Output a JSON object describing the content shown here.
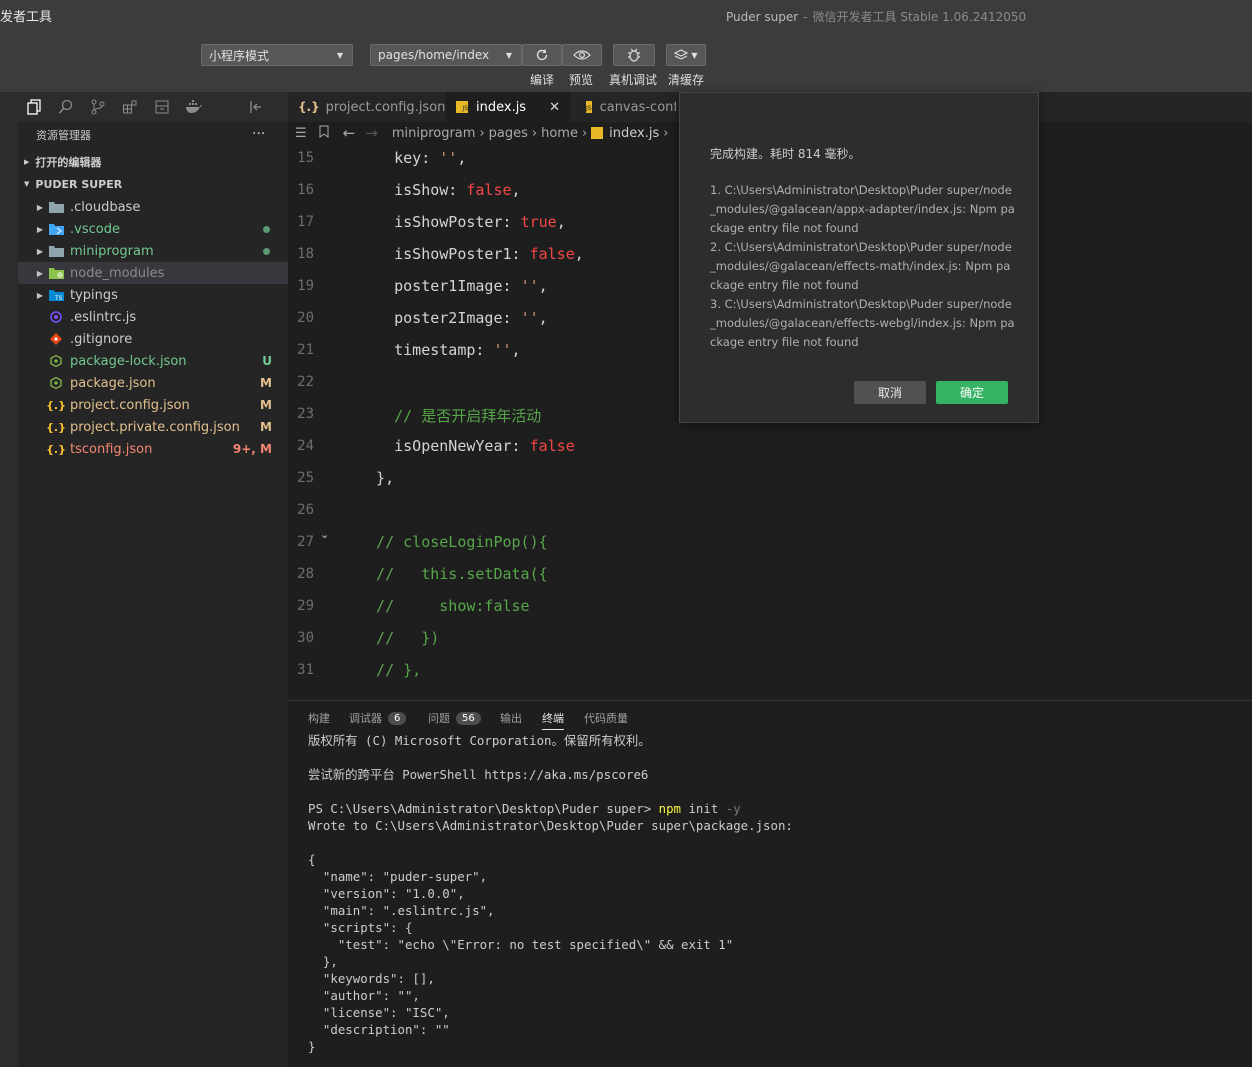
{
  "titlebar": {
    "app_title": "发者工具",
    "window_title": "Puder super",
    "window_subtitle": "微信开发者工具 Stable 1.06.2412050",
    "mode_select": "小程序模式",
    "page_select": "pages/home/index",
    "labels": {
      "compile": "编译",
      "preview": "预览",
      "real_debug": "真机调试",
      "clear_cache": "清缓存"
    }
  },
  "explorer": {
    "header": "资源管理器",
    "more": "···",
    "open_editors": "打开的编辑器",
    "project": "PUDER SUPER",
    "items": [
      {
        "label": ".cloudbase",
        "icon": "folder-icon",
        "color": "#cccccc",
        "badge": "",
        "dot": false
      },
      {
        "label": ".vscode",
        "icon": "vscode-folder-icon",
        "color": "#73c991",
        "badge": "",
        "dot": true
      },
      {
        "label": "miniprogram",
        "icon": "folder-icon",
        "color": "#73c991",
        "badge": "",
        "dot": true
      },
      {
        "label": "node_modules",
        "icon": "node-folder-icon",
        "color": "#8c8c8c",
        "badge": "",
        "dot": false
      },
      {
        "label": "typings",
        "icon": "ts-folder-icon",
        "color": "#cccccc",
        "badge": "",
        "dot": false
      },
      {
        "label": ".eslintrc.js",
        "icon": "eslint-icon",
        "color": "#cccccc",
        "badge": "",
        "dot": false
      },
      {
        "label": ".gitignore",
        "icon": "git-icon",
        "color": "#cccccc",
        "badge": "",
        "dot": false
      },
      {
        "label": "package-lock.json",
        "icon": "npm-icon",
        "color": "#73c991",
        "badge": "U",
        "dot": false
      },
      {
        "label": "package.json",
        "icon": "npm-icon",
        "color": "#e2c08d",
        "badge": "M",
        "dot": false
      },
      {
        "label": "project.config.json",
        "icon": "json-icon",
        "color": "#e2c08d",
        "badge": "M",
        "dot": false
      },
      {
        "label": "project.private.config.json",
        "icon": "json-icon",
        "color": "#e2c08d",
        "badge": "M",
        "dot": false
      },
      {
        "label": "tsconfig.json",
        "icon": "json-icon",
        "color": "#f48771",
        "badge": "9+, M",
        "dot": false
      }
    ]
  },
  "tabs": [
    {
      "label": "project.config.json",
      "icon": "json-icon"
    },
    {
      "label": "index.js",
      "icon": "js-icon",
      "close": "✕"
    },
    {
      "label": "canvas-confe",
      "icon": "js-icon"
    }
  ],
  "breadcrumb": [
    "miniprogram",
    "pages",
    "home",
    "index.js"
  ],
  "editor": {
    "lines": [
      {
        "n": "15",
        "parts": [
          [
            "k",
            "    key: "
          ],
          [
            "s",
            "''"
          ],
          [
            "k",
            ","
          ]
        ]
      },
      {
        "n": "16",
        "parts": [
          [
            "k",
            "    isShow: "
          ],
          [
            "p",
            "false"
          ],
          [
            "k",
            ","
          ]
        ]
      },
      {
        "n": "17",
        "parts": [
          [
            "k",
            "    isShowPoster: "
          ],
          [
            "p",
            "true"
          ],
          [
            "k",
            ","
          ]
        ]
      },
      {
        "n": "18",
        "parts": [
          [
            "k",
            "    isShowPoster1: "
          ],
          [
            "p",
            "false"
          ],
          [
            "k",
            ","
          ]
        ]
      },
      {
        "n": "19",
        "parts": [
          [
            "k",
            "    poster1Image: "
          ],
          [
            "s",
            "''"
          ],
          [
            "k",
            ","
          ]
        ]
      },
      {
        "n": "20",
        "parts": [
          [
            "k",
            "    poster2Image: "
          ],
          [
            "s",
            "''"
          ],
          [
            "k",
            ","
          ]
        ]
      },
      {
        "n": "21",
        "parts": [
          [
            "k",
            "    timestamp: "
          ],
          [
            "s",
            "''"
          ],
          [
            "k",
            ","
          ]
        ]
      },
      {
        "n": "22",
        "parts": []
      },
      {
        "n": "23",
        "parts": [
          [
            "c",
            "    // 是否开启拜年活动"
          ]
        ]
      },
      {
        "n": "24",
        "parts": [
          [
            "k",
            "    isOpenNewYear: "
          ],
          [
            "p",
            "false"
          ]
        ]
      },
      {
        "n": "25",
        "parts": [
          [
            "k",
            "  },"
          ]
        ]
      },
      {
        "n": "26",
        "parts": []
      },
      {
        "n": "27",
        "parts": [
          [
            "c",
            "  // closeLoginPop(){"
          ]
        ]
      },
      {
        "n": "28",
        "parts": [
          [
            "c",
            "  //   this.setData({"
          ]
        ]
      },
      {
        "n": "29",
        "parts": [
          [
            "c",
            "  //     show:false"
          ]
        ]
      },
      {
        "n": "30",
        "parts": [
          [
            "c",
            "  //   })"
          ]
        ]
      },
      {
        "n": "31",
        "parts": [
          [
            "c",
            "  // },"
          ]
        ]
      }
    ]
  },
  "panel": {
    "tabs": {
      "build": "构建",
      "debugger": "调试器",
      "debugger_count": "6",
      "problems": "问题",
      "problems_count": "56",
      "output": "输出",
      "terminal": "终端",
      "quality": "代码质量"
    }
  },
  "terminal": {
    "lines": [
      [
        [
          "",
          "版权所有 (C) Microsoft Corporation。保留所有权利。"
        ]
      ],
      [],
      [
        [
          "",
          "尝试新的跨平台 PowerShell https://aka.ms/pscore6"
        ]
      ],
      [],
      [
        [
          "",
          "PS C:\\Users\\Administrator\\Desktop\\Puder super> "
        ],
        [
          "yellow",
          "npm"
        ],
        [
          "",
          " init "
        ],
        [
          "gray",
          "-y"
        ]
      ],
      [
        [
          "",
          "Wrote to C:\\Users\\Administrator\\Desktop\\Puder super\\package.json:"
        ]
      ],
      [],
      [
        [
          "",
          "{"
        ]
      ],
      [
        [
          "",
          "  \"name\": \"puder-super\","
        ]
      ],
      [
        [
          "",
          "  \"version\": \"1.0.0\","
        ]
      ],
      [
        [
          "",
          "  \"main\": \".eslintrc.js\","
        ]
      ],
      [
        [
          "",
          "  \"scripts\": {"
        ]
      ],
      [
        [
          "",
          "    \"test\": \"echo \\\"Error: no test specified\\\" && exit 1\""
        ]
      ],
      [
        [
          "",
          "  },"
        ]
      ],
      [
        [
          "",
          "  \"keywords\": [],"
        ]
      ],
      [
        [
          "",
          "  \"author\": \"\","
        ]
      ],
      [
        [
          "",
          "  \"license\": \"ISC\","
        ]
      ],
      [
        [
          "",
          "  \"description\": \"\""
        ]
      ],
      [
        [
          "",
          "}"
        ]
      ]
    ]
  },
  "dialog": {
    "title": "完成构建。耗时 814 毫秒。",
    "errors": [
      "1. C:\\Users\\Administrator\\Desktop\\Puder super/node_modules/@galacean/appx-adapter/index.js: Npm package entry file not found",
      "2. C:\\Users\\Administrator\\Desktop\\Puder super/node_modules/@galacean/effects-math/index.js: Npm package entry file not found",
      "3. C:\\Users\\Administrator\\Desktop\\Puder super/node_modules/@galacean/effects-webgl/index.js: Npm package entry file not found"
    ],
    "cancel": "取消",
    "confirm": "确定"
  }
}
